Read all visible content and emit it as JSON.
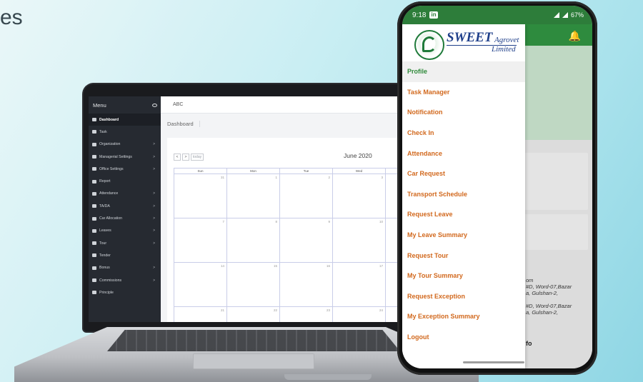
{
  "corner_text": "es",
  "laptop": {
    "sidebar": {
      "title": "Menu",
      "items": [
        {
          "label": "Dashboard",
          "has_chevron": false
        },
        {
          "label": "Task",
          "has_chevron": false
        },
        {
          "label": "Organization",
          "has_chevron": true
        },
        {
          "label": "Managerial Settings",
          "has_chevron": true
        },
        {
          "label": "Office Settings",
          "has_chevron": true
        },
        {
          "label": "Report",
          "has_chevron": false
        },
        {
          "label": "Attendance",
          "has_chevron": true
        },
        {
          "label": "TA/DA",
          "has_chevron": true
        },
        {
          "label": "Car Allocation",
          "has_chevron": true
        },
        {
          "label": "Leaves",
          "has_chevron": true
        },
        {
          "label": "Tour",
          "has_chevron": true
        },
        {
          "label": "Tender",
          "has_chevron": false
        },
        {
          "label": "Bonus",
          "has_chevron": true
        },
        {
          "label": "Commissions",
          "has_chevron": true
        },
        {
          "label": "Principle",
          "has_chevron": false
        }
      ],
      "chevron": ">"
    },
    "topbar_text": "ABC",
    "breadcrumb": "Dashboard",
    "calendar": {
      "prev": "<",
      "next": ">",
      "today": "today",
      "title": "June 2020",
      "weekdays": [
        "Sun",
        "Mon",
        "Tue",
        "Wed"
      ],
      "weeks": [
        [
          "31",
          "1",
          "2",
          "3"
        ],
        [
          "7",
          "8",
          "9",
          "10"
        ],
        [
          "14",
          "15",
          "16",
          "17"
        ],
        [
          "21",
          "22",
          "23",
          "24"
        ]
      ]
    }
  },
  "phone": {
    "status": {
      "time": "9:18",
      "app_badge": "in",
      "battery": "67%"
    },
    "logo": {
      "name": "SWEET",
      "suffix": "Agrovet",
      "sub": "Limited"
    },
    "menu": [
      "Profile",
      "Task Manager",
      "Notification",
      "Check In",
      "Attendance",
      "Car Request",
      "Transport Schedule",
      "Request Leave",
      "My Leave Summary",
      "Request Tour",
      "My Tour Summary",
      "Request Exception",
      "My Exception Summary",
      "Logout"
    ],
    "selected_index": 0,
    "background": {
      "line1": "om",
      "line2": "#D, Word-07,Bazar",
      "line3": "a, Gulshan-2,",
      "line4": "#D, Word-07,Bazar",
      "line5": "a, Gulshan-2,",
      "footer": "fo"
    }
  },
  "colors": {
    "drawer_text": "#d2691e",
    "drawer_selected": "#2f8a3a",
    "status_bar": "#2d7d3a",
    "laptop_sidebar": "#262a31"
  }
}
